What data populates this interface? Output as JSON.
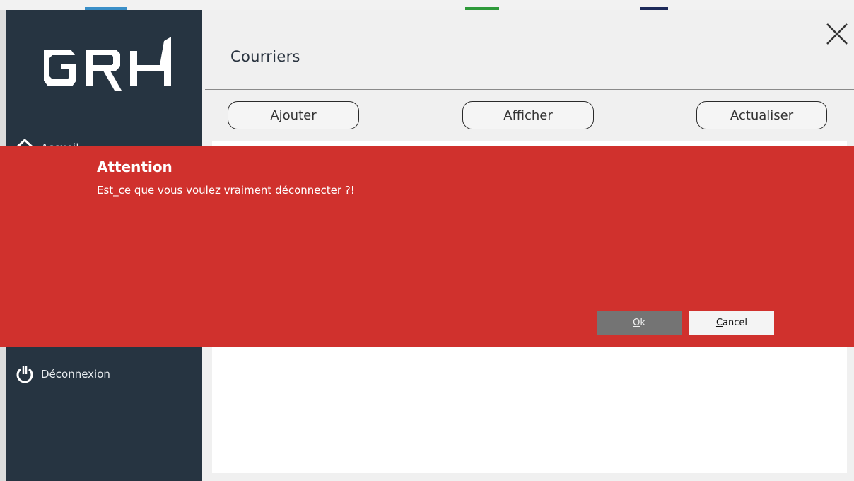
{
  "app": {
    "logo_text": "GRH",
    "page_title": "Courriers"
  },
  "sidebar": {
    "items": [
      {
        "label": "Accueil",
        "icon": "home-icon"
      },
      {
        "label": "Déconnexion",
        "icon": "power-icon"
      }
    ]
  },
  "toolbar": {
    "add_label": "Ajouter",
    "show_label": "Afficher",
    "refresh_label": "Actualiser"
  },
  "dialog": {
    "title": "Attention",
    "message": "Est_ce que vous voulez vraiment déconnecter ?!",
    "ok_mnemonic": "O",
    "ok_rest": "k",
    "cancel_mnemonic": "C",
    "cancel_rest": "ancel"
  },
  "colors": {
    "sidebar_bg": "#263441",
    "alert_bg": "#d0312d",
    "ok_bg": "#747474",
    "cancel_bg": "#f4f4f4"
  }
}
